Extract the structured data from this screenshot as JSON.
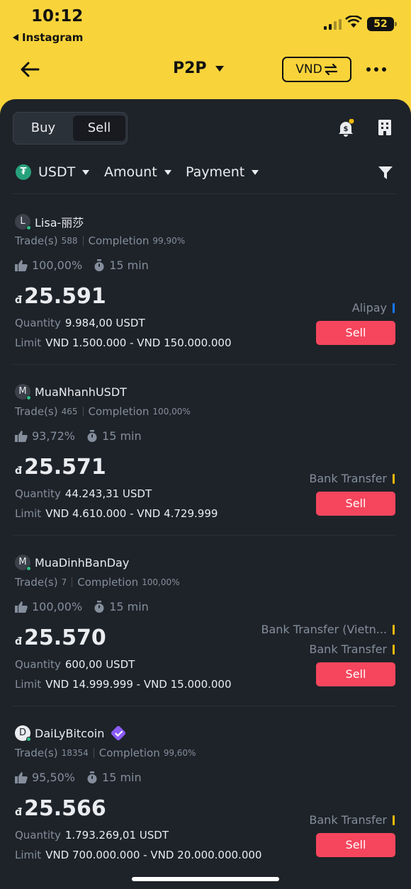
{
  "status_bar": {
    "time": "10:12",
    "back_app": "Instagram",
    "battery": "52"
  },
  "nav": {
    "title": "P2P",
    "fiat": "VND"
  },
  "tabs": {
    "buy": "Buy",
    "sell": "Sell",
    "active": "Sell"
  },
  "filters": {
    "asset": "USDT",
    "amount": "Amount",
    "payment": "Payment"
  },
  "labels": {
    "trades": "Trade(s)",
    "completion": "Completion",
    "quantity": "Quantity",
    "limit": "Limit",
    "sell_button": "Sell",
    "currency_symbol": "đ"
  },
  "ads": [
    {
      "avatar": "L",
      "name": "Lisa-丽莎",
      "verified": false,
      "trades": "588",
      "completion": "99,90%",
      "positive_rate": "100,00%",
      "release_time": "15 min",
      "price": "25.591",
      "quantity": "9.984,00 USDT",
      "limit": "VND 1.500.000 - VND 150.000.000",
      "payments": [
        {
          "name": "Alipay",
          "color": "#1677FF"
        }
      ]
    },
    {
      "avatar": "M",
      "name": "MuaNhanhUSDT",
      "verified": false,
      "trades": "465",
      "completion": "100,00%",
      "positive_rate": "93,72%",
      "release_time": "15 min",
      "price": "25.571",
      "quantity": "44.243,31 USDT",
      "limit": "VND 4.610.000 - VND 4.729.999",
      "payments": [
        {
          "name": "Bank Transfer",
          "color": "#F0B90B"
        }
      ]
    },
    {
      "avatar": "M",
      "name": "MuaDinhBanDay",
      "verified": false,
      "trades": "7",
      "completion": "100,00%",
      "positive_rate": "100,00%",
      "release_time": "15 min",
      "price": "25.570",
      "quantity": "600,00 USDT",
      "limit": "VND 14.999.999 - VND 15.000.000",
      "payments": [
        {
          "name": "Bank Transfer (Vietn...",
          "color": "#F0B90B"
        },
        {
          "name": "Bank Transfer",
          "color": "#F0B90B"
        }
      ]
    },
    {
      "avatar": "D",
      "name": "DaiLyBitcoin",
      "verified": true,
      "trades": "18354",
      "completion": "99,60%",
      "positive_rate": "95,50%",
      "release_time": "15 min",
      "price": "25.566",
      "quantity": "1.793.269,01 USDT",
      "limit": "VND 700.000.000 - VND 20.000.000.000",
      "payments": [
        {
          "name": "Bank Transfer",
          "color": "#F0B90B"
        }
      ]
    }
  ],
  "icons": {
    "back": "arrow-left-icon",
    "swap": "swap-arrows-icon",
    "more": "more-dots-icon",
    "bell": "notification-bell-icon",
    "orders": "orders-icon",
    "filter": "funnel-icon",
    "thumb": "thumbs-up-icon",
    "timer": "stopwatch-icon"
  },
  "colors": {
    "brand_yellow": "#F8D33A",
    "sell_red": "#F6465D",
    "panel_bg": "#1E2329"
  }
}
